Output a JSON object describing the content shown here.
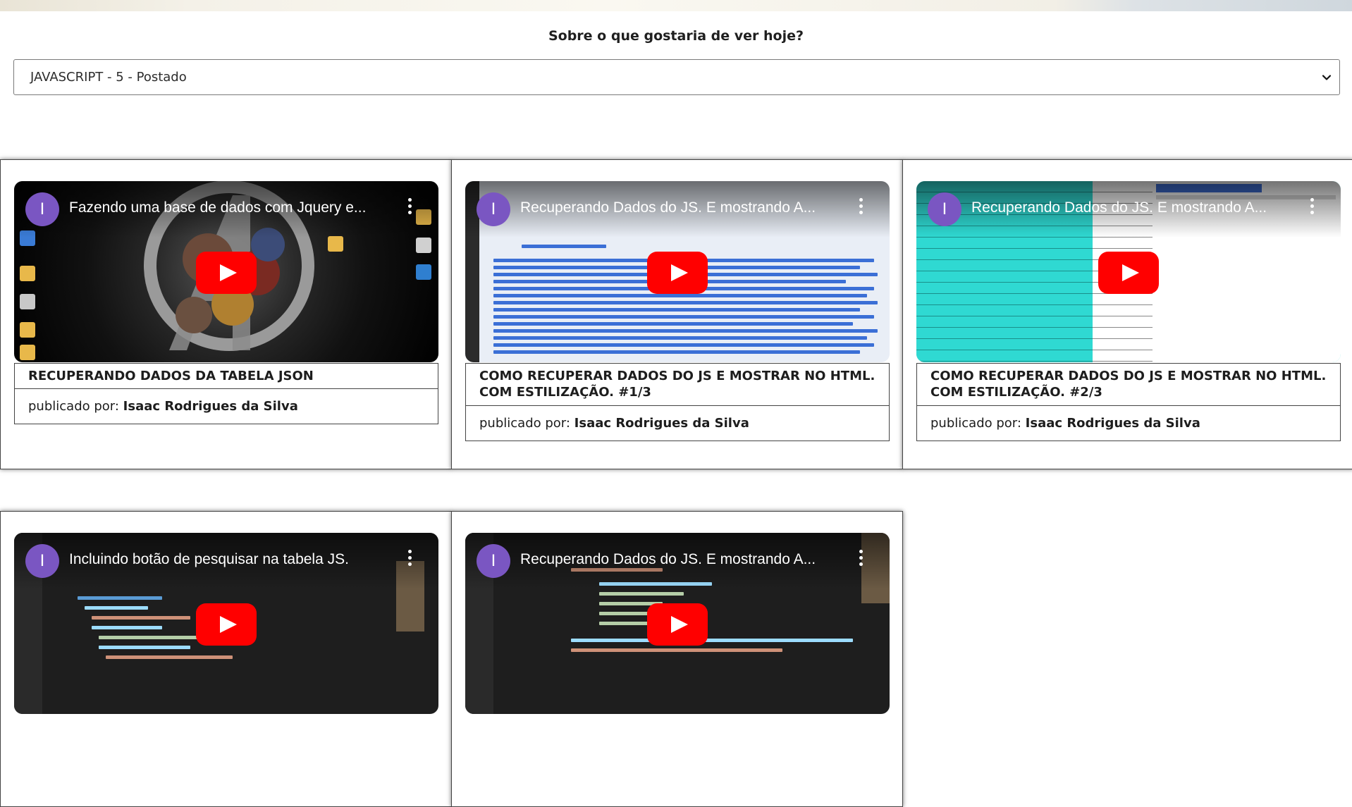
{
  "question": "Sobre o que gostaria de ver hoje?",
  "select": {
    "value": "JAVASCRIPT - 5 - Postado"
  },
  "published_prefix": "publicado por:",
  "cards": [
    {
      "channel_initial": "I",
      "video_title": "Fazendo uma base de dados com Jquery e...",
      "title": "RECUPERANDO DADOS DA TABELA JSON",
      "author": "Isaac Rodrigues da Silva"
    },
    {
      "channel_initial": "I",
      "video_title": "Recuperando Dados do JS. E mostrando A...",
      "title": "COMO RECUPERAR DADOS DO JS E MOSTRAR NO HTML. COM ESTILIZAÇÃO. #1/3",
      "author": "Isaac Rodrigues da Silva"
    },
    {
      "channel_initial": "I",
      "video_title": "Recuperando Dados do JS. E mostrando A...",
      "title": "COMO RECUPERAR DADOS DO JS E MOSTRAR NO HTML. COM ESTILIZAÇÃO. #2/3",
      "author": "Isaac Rodrigues da Silva"
    },
    {
      "channel_initial": "I",
      "video_title": "Incluindo botão de pesquisar na tabela JS.",
      "title": "",
      "author": ""
    },
    {
      "channel_initial": "I",
      "video_title": "Recuperando Dados do JS. E mostrando A...",
      "title": "",
      "author": ""
    }
  ],
  "colors": {
    "avatar": "#7a56c2",
    "play_red": "#ff0000",
    "border": "#444444"
  },
  "icons": {
    "play": "youtube-play-icon",
    "kebab": "more-vert-icon",
    "caret": "chevron-down-icon"
  }
}
